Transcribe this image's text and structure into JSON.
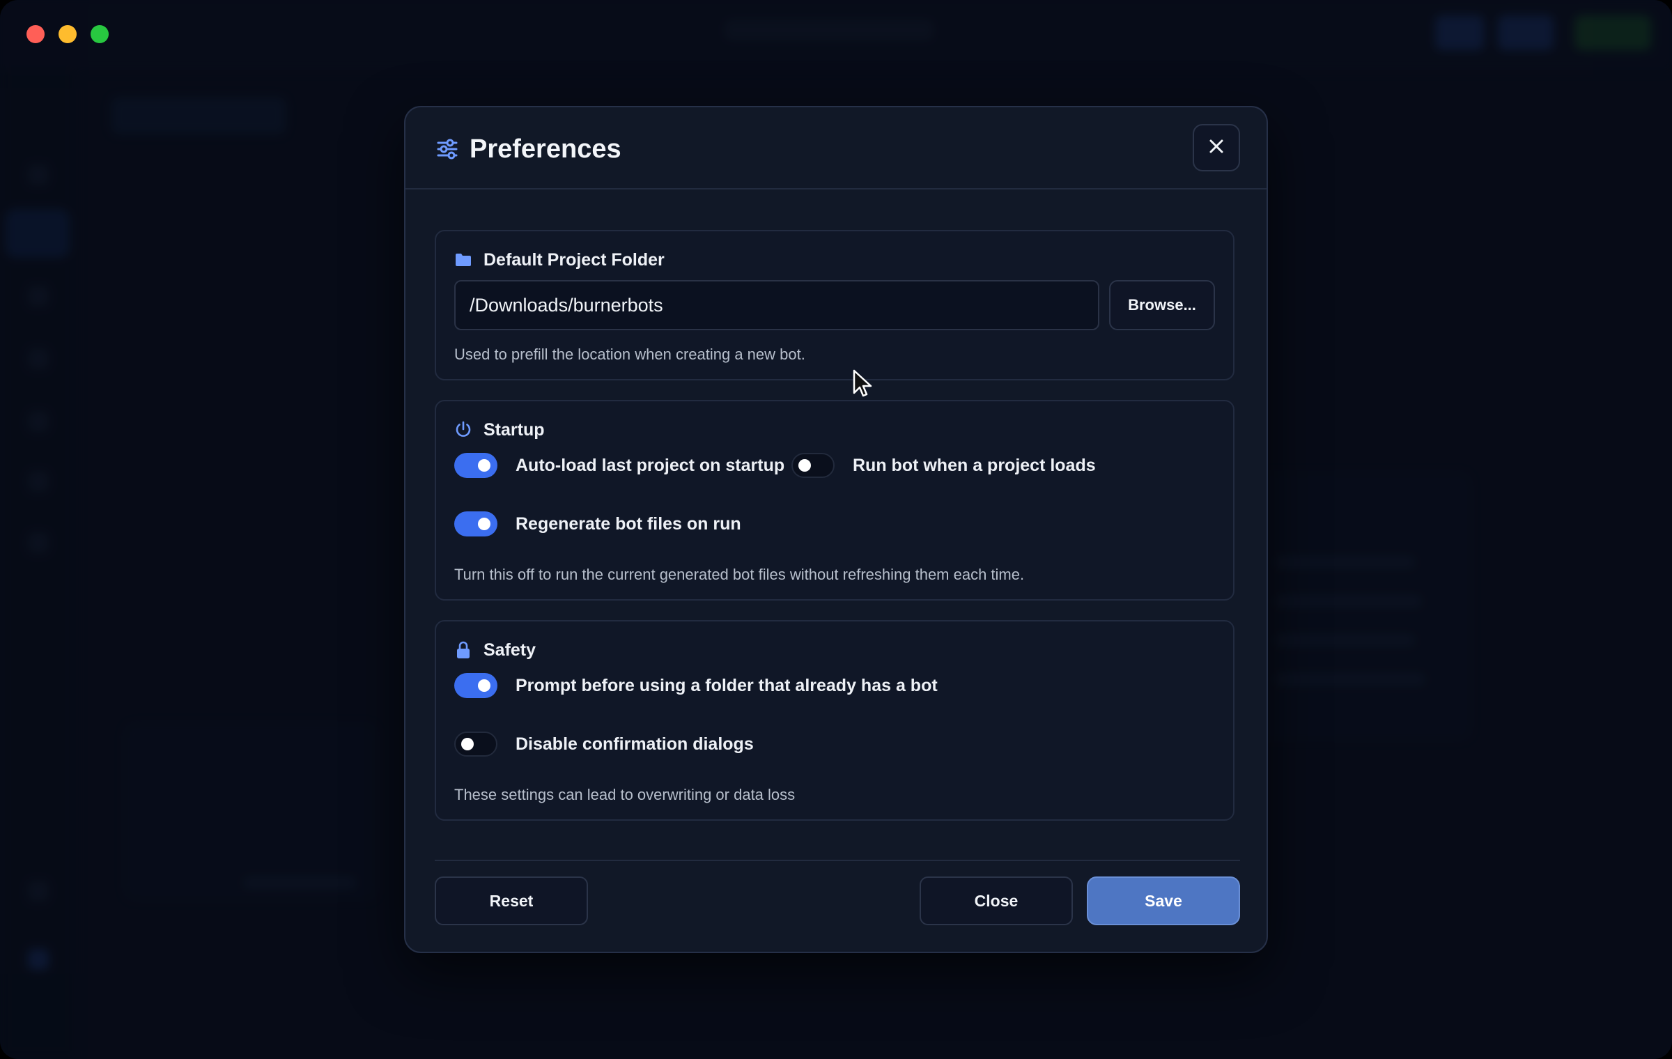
{
  "window": {
    "controls": [
      "close",
      "minimize",
      "zoom"
    ]
  },
  "modal": {
    "title": "Preferences",
    "title_icon": "sliders-icon",
    "close_icon": "close-icon"
  },
  "sections": {
    "folder": {
      "title": "Default Project Folder",
      "icon": "folder-icon",
      "path_value": "/Downloads/burnerbots",
      "browse_label": "Browse...",
      "hint": "Used to prefill the location when creating a new bot."
    },
    "startup": {
      "title": "Startup",
      "icon": "power-icon",
      "toggles": [
        {
          "label": "Auto-load last project on startup",
          "on": true
        },
        {
          "label": "Run bot when a project loads",
          "on": false
        },
        {
          "label": "Regenerate bot files on run",
          "on": true
        }
      ],
      "hint": "Turn this off to run the current generated bot files without refreshing them each time."
    },
    "safety": {
      "title": "Safety",
      "icon": "lock-icon",
      "toggles": [
        {
          "label": "Prompt before using a folder that already has a bot",
          "on": true
        },
        {
          "label": "Disable confirmation dialogs",
          "on": false
        }
      ],
      "hint": "These settings can lead to overwriting or data loss"
    }
  },
  "footer": {
    "reset_label": "Reset",
    "close_label": "Close",
    "save_label": "Save"
  },
  "colors": {
    "accent": "#3b6ef0",
    "save_button": "#4e76c3",
    "modal_bg": "#111827"
  }
}
